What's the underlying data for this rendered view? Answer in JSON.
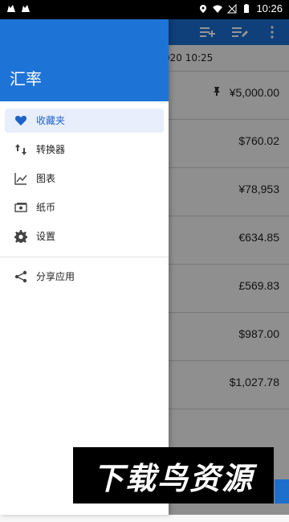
{
  "status_bar": {
    "time": "10:26",
    "icons": [
      "cat-icon",
      "cat-icon",
      "location-icon",
      "wifi-icon",
      "signal-icon",
      "battery-icon"
    ]
  },
  "drawer": {
    "title": "汇率",
    "items": [
      {
        "label": "收藏夹",
        "icon": "heart-icon",
        "selected": true
      },
      {
        "label": "转换器",
        "icon": "swap-icon",
        "selected": false
      },
      {
        "label": "图表",
        "icon": "chart-icon",
        "selected": false
      },
      {
        "label": "纸币",
        "icon": "banknote-icon",
        "selected": false
      },
      {
        "label": "设置",
        "icon": "gear-icon",
        "selected": false
      }
    ],
    "share": {
      "label": "分享应用",
      "icon": "share-icon"
    }
  },
  "app": {
    "update_time_partial": "020 10:25",
    "toolbar_icons": [
      "add-list-icon",
      "edit-list-icon",
      "more-icon"
    ],
    "rows": [
      {
        "value": "¥5,000.00",
        "pinned": true
      },
      {
        "value": "$760.02"
      },
      {
        "value": "¥78,953"
      },
      {
        "value": "€634.85"
      },
      {
        "value": "£569.83"
      },
      {
        "value": "$987.00"
      },
      {
        "value": "$1,027.78"
      }
    ]
  },
  "watermark": {
    "text": "下载鸟资源"
  },
  "colors": {
    "primary": "#1e74d6",
    "selected_bg": "#e8eefb",
    "selected_text": "#1e64c8"
  }
}
